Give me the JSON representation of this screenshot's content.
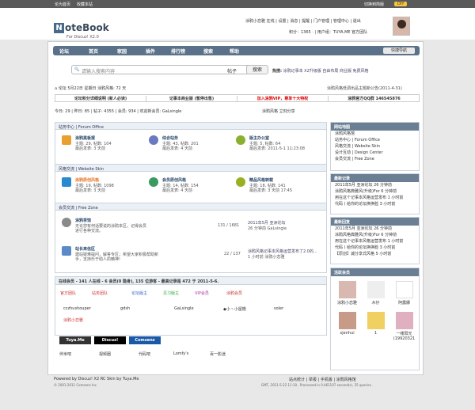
{
  "top": {
    "left1": "论为首页",
    "left2": "收藏本站",
    "right1": "切换到简版",
    "right2": "DIY"
  },
  "logo": {
    "mark": "N",
    "text": "oteBook",
    "sub": "For Discuz! X2.0"
  },
  "user": {
    "line1": "涂鸦小恋雅 在线 | 设置 | 消息 | 提醒 | 门户管理 | 管理中心 | 退出",
    "line2": "积分：1365 · | 用户组：TUYA.ME 官方团队"
  },
  "nav": {
    "items": [
      "论坛",
      "首页",
      "家园",
      "插件",
      "排行榜",
      "搜索",
      "帮助"
    ],
    "btn": "快捷导航"
  },
  "search": {
    "placeholder": "请输入搜索内容",
    "type": "帖子",
    "btn": "搜索",
    "hot_label": "热搜:",
    "hot": "涂鸦记事本  X2升级版  自由布局  商业版  免费风格"
  },
  "crumb": {
    "text": "论坛   5月22日 星期日   涂鸦风格: 72 天",
    "notice": "涂鸦风格低调出品主题新公告(2011-4-31)"
  },
  "ads": [
    "论坛积分详细说明 (新人必读)",
    "记事本商业版 (暂停出售)",
    "加入涂鸦VIP，尊享十大特权",
    "涂鸦官方QQ群 146545876"
  ],
  "stats": {
    "text": "今日: 29 | 昨日: 85 | 帖子: 4355 | 会员: 934 | 欢迎新会员: GaLsingle",
    "quick": "涂鸦风格 立刻分享"
  },
  "sections": [
    {
      "title": "站务中心 | Forum Office",
      "forums": [
        {
          "name": "涂鸦黑板报",
          "l1": "主题: 29, 帖数: 104",
          "l2": "最后发表: 3 天前",
          "color": "#e8a030"
        },
        {
          "name": "综合站务",
          "l1": "主题: 43, 帖数: 201",
          "l2": "最后发表: 4 天前",
          "color": "#6a7ac0"
        },
        {
          "name": "版主办公室",
          "l1": "主题: 5, 帖数: 64",
          "l2": "最后发表: 2011-5-1 11:23:08",
          "color": "#8ab030"
        }
      ]
    },
    {
      "title": "风格交流 | Website Skin",
      "forums": [
        {
          "name": "涂鸦原创风格",
          "l1": "主题: 19, 帖数: 1098",
          "l2": "最后发表: 3 天前",
          "color": "#2a8ad0"
        },
        {
          "name": "会员原创风格",
          "l1": "主题: 14, 帖数: 154",
          "l2": "最后发表: 4 天前",
          "color": "#3a9a60"
        },
        {
          "name": "精品风格转载",
          "l1": "主题: 18, 帖数: 141",
          "l2": "最后发表: 3 天前 17:45",
          "color": "#9ab020"
        }
      ]
    },
    {
      "title": "会员交流 | Free Zone",
      "forums": [
        {
          "name": "涂鸦茶馆",
          "l1": "无论您有何话要说的涂鸦本区，记得会员",
          "l2": "进行各种交流。",
          "count": "131 / 1681",
          "last": "2011年5月 亚洲论坛",
          "lastby": "26 分钟前 GaLsingle",
          "color": "#8a8a8a"
        },
        {
          "name": "站长来信区",
          "l1": "建站疑难提问，解答专区；希望大家积极帮助新",
          "l2": "手，支持乐于助人的精神!",
          "count": "22 / 137",
          "last": "涂鸦风格记事本风格运营发布了2.0的...",
          "lastby": "1 小时前 涂鸦小恋雅",
          "color": "#5a8ac8"
        }
      ]
    }
  ],
  "online": {
    "title": "在线会员 - 141 人在线 - 6 会员(0 隐身), 135 位游客 - 最高记录是 472 于 2011-5-6.",
    "legend": [
      "官方团队",
      "站务团队",
      "论坛版主",
      "见习版主",
      "VIP会员",
      "涂鸦会员"
    ],
    "users": [
      "cczhushouper",
      "gdsh",
      "GaLsingle",
      "◆小丶小屋檐",
      "soler",
      "涂鸦小恋雅"
    ]
  },
  "links": {
    "row": [
      "伴米吧",
      "视频圈",
      "代码吧",
      "Lomfy's",
      "百一影迷"
    ],
    "b1": "Tuya.Me",
    "b2": "Discuz!",
    "b3": "Comsenz"
  },
  "side": [
    {
      "title": "网站地图",
      "items": [
        "涂鸦风格馆",
        "站务中心 | Forum Office",
        "风格交流 | Website Skin",
        "设计互动 | Design Center",
        "会员交流 | Free Zone"
      ]
    },
    {
      "title": "最新记录",
      "items": [
        "2011年5月 亚洲论坛    26 分钟前",
        "涂鸦风格典雅风(升级)For   6 分钟前",
        "用在这个记事本风格运营发布    1 小时前",
        "代码丨给你的论坛换换脸    3 小时前"
      ]
    },
    {
      "title": "最新回复",
      "items": [
        "2011年5月 亚洲论坛    26 分钟前",
        "涂鸦风格典雅风(升级)For   6 分钟前",
        "用在这个记事本风格运营发布    1 小时前",
        "代码丨给你的论坛换换脸    3 小时前",
        "【原创】诚分享式风格    5 小时前"
      ]
    },
    {
      "title": "活跃会员",
      "items": []
    }
  ],
  "members": [
    "涂鸦小恋雅",
    "木仔",
    "阿露娜",
    "xjenhui",
    "1",
    "一缕阳光(19920321"
  ],
  "footer": {
    "left": "Powered by Discuz! X2 RC Skin by Tuya.Me",
    "left2": "© 2001-2011 Comsenz Inc.",
    "right": "站点统计 | 举报 | 手机版 | 涂鸦风格馆",
    "right2": "GMT, 2011-5-22 11:10 , Processed in 0.461107 second(s), 25 queries ."
  }
}
